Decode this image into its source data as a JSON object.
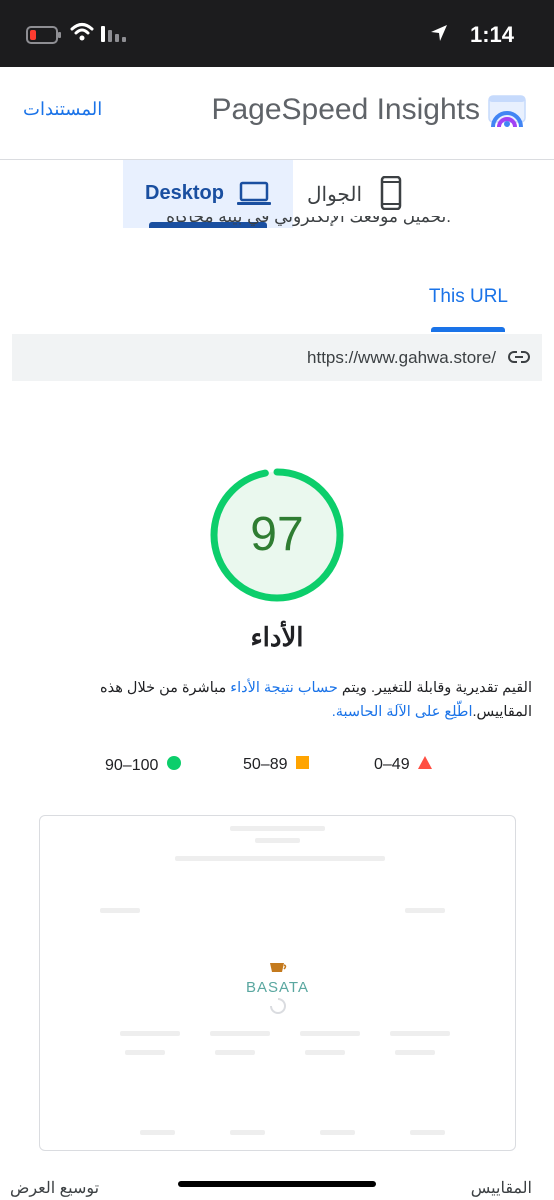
{
  "status_bar": {
    "time": "1:14"
  },
  "header": {
    "brand": "PageSpeed Insights",
    "docs_link": "المستندات"
  },
  "device_tabs": {
    "desktop": "Desktop",
    "mobile": "الجوال"
  },
  "clipped_text": "تحميل موقعك الإلكتروني في بيئة محاكاة.",
  "url_tab": "This URL",
  "url": "https://www.gahwa.store/",
  "performance": {
    "score": "97",
    "title": "الأداء",
    "desc_part1": "القيم تقديرية وقابلة للتغيير. ويتم ",
    "desc_link1": "حساب نتيجة الأداء",
    "desc_part2": " مباشرة من خلال هذه المقاييس.",
    "desc_link2": "اطّلِع على الآلة الحاسبة."
  },
  "legend": {
    "fail": "0–49",
    "average": "50–89",
    "pass": "90–100"
  },
  "screenshot": {
    "logo_text": "BASATA"
  },
  "bottom": {
    "left": "توسيع العرض",
    "right": "المقاييس"
  },
  "colors": {
    "pass": "#0cce6b",
    "average": "#ffa400",
    "fail": "#ff4e42",
    "link": "#1a73e8"
  }
}
